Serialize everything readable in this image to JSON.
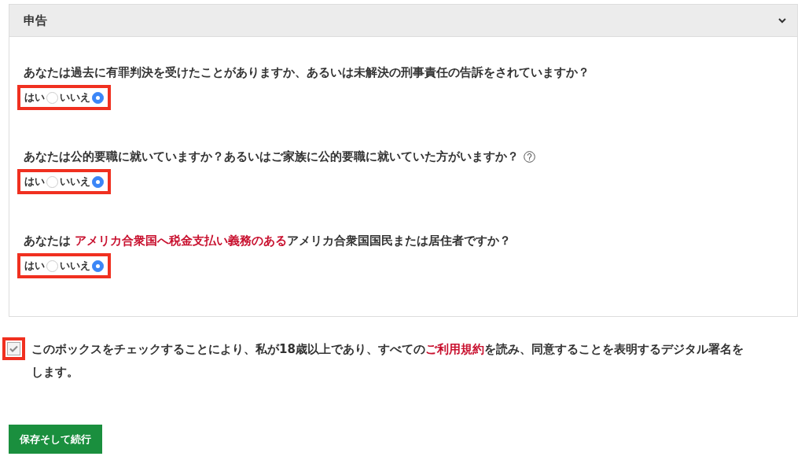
{
  "panel": {
    "title": "申告",
    "expanded": true
  },
  "questions": [
    {
      "parts": [
        {
          "kind": "text",
          "text": "あなたは過去に有罪判決を受けたことがありますか、あるいは未解決の刑事責任の告訴をされていますか？"
        }
      ],
      "help": false,
      "highlighted": true,
      "options": [
        {
          "label": "はい",
          "selected": false
        },
        {
          "label": "いいえ",
          "selected": true
        }
      ]
    },
    {
      "parts": [
        {
          "kind": "text",
          "text": "あなたは公的要職に就いていますか？あるいはご家族に公的要職に就いていた方がいますか？"
        }
      ],
      "help": true,
      "highlighted": true,
      "options": [
        {
          "label": "はい",
          "selected": false
        },
        {
          "label": "いいえ",
          "selected": true
        }
      ]
    },
    {
      "parts": [
        {
          "kind": "text",
          "text": "あなたは "
        },
        {
          "kind": "link",
          "text": "アメリカ合衆国へ税金支払い義務のある"
        },
        {
          "kind": "text",
          "text": "アメリカ合衆国国民または居住者ですか？"
        }
      ],
      "help": false,
      "highlighted": true,
      "options": [
        {
          "label": "はい",
          "selected": false
        },
        {
          "label": "いいえ",
          "selected": true
        }
      ]
    }
  ],
  "agreement": {
    "checked": true,
    "highlighted": true,
    "parts": [
      {
        "kind": "text",
        "text": "このボックスをチェックすることにより、私が18歳以上であり、すべての"
      },
      {
        "kind": "link",
        "text": "ご利用規約"
      },
      {
        "kind": "text",
        "text": "を読み、同意することを表明するデジタル署名をします。"
      }
    ]
  },
  "submit_button": "保存そして続行"
}
